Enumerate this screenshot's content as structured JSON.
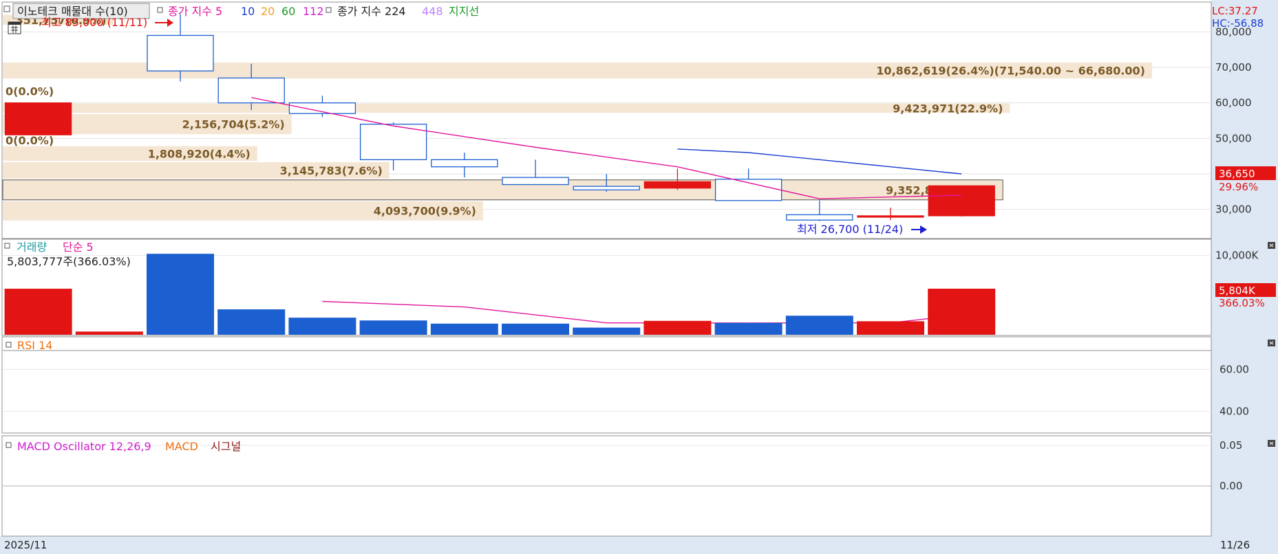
{
  "price_panel": {
    "title": "이노테크 매물대 수(10)",
    "legend": [
      {
        "label": "종가 지수 5",
        "color": "#e0149b"
      },
      {
        "label": "10",
        "color": "#1b3ccf"
      },
      {
        "label": "20",
        "color": "#f0a020"
      },
      {
        "label": "60",
        "color": "#1e9a28"
      },
      {
        "label": "112",
        "color": "#d020d0"
      },
      {
        "label": "종가 지수 224",
        "color": "#222222"
      },
      {
        "label": "448",
        "color": "#c080ff"
      },
      {
        "label": "지지선",
        "color": "#1e9a28"
      }
    ],
    "lc_text": "LC:37.27",
    "hc_text": "HC:-56.88",
    "current_price": "36,650",
    "current_change": "29.96%",
    "high_note": "최고 85,000 (11/11)",
    "low_note": "최저 26,700 (11/24)",
    "volume_profile_labels": [
      "351,757(0.9%)",
      "10,862,619(26.4%)(71,540.00 ~ 66,680.00)",
      "0(0.0%)",
      "9,423,971(22.9%)",
      "2,156,704(5.2%)",
      "0(0.0%)",
      "1,808,920(4.4%)",
      "3,145,783(7.6%)",
      "9,352,887(22.7%)",
      "4,093,700(9.9%)"
    ]
  },
  "volume_panel": {
    "title": "거래량",
    "ma_label": "단순 5",
    "info": "5,803,777주(366.03%)",
    "current_value": "5,804K",
    "current_pct": "366.03%"
  },
  "rsi_panel": {
    "title": "RSI 14"
  },
  "macd_panel": {
    "title": "MACD Oscillator 12,26,9",
    "macd_label": "MACD",
    "signal_label": "시그널"
  },
  "x_axis": {
    "start_label": "2025/11",
    "end_label": "11/26"
  },
  "chart_data": [
    {
      "type": "candlestick",
      "title": "이노테크 매물대 수(10)",
      "categories": [
        "1",
        "2",
        "3",
        "4",
        "5",
        "6",
        "7",
        "8",
        "9",
        "10",
        "11",
        "12",
        "13",
        "14"
      ],
      "open": [
        51000,
        null,
        69000,
        67000,
        60000,
        54000,
        42000,
        39000,
        36500,
        36000,
        38500,
        28500,
        28200,
        28200
      ],
      "close": [
        60000,
        null,
        79000,
        60000,
        57000,
        44000,
        44000,
        37000,
        35500,
        37800,
        32500,
        27000,
        28000,
        36650
      ],
      "high": [
        60000,
        null,
        85000,
        71000,
        62000,
        54500,
        46000,
        44000,
        40000,
        41500,
        41500,
        32500,
        30500,
        36650
      ],
      "low": [
        51000,
        null,
        66000,
        58000,
        56000,
        41000,
        39000,
        37000,
        35000,
        35500,
        32500,
        26700,
        27000,
        28000
      ],
      "up": [
        true,
        false,
        false,
        false,
        false,
        false,
        false,
        false,
        false,
        true,
        false,
        false,
        true,
        true
      ],
      "ma5": [
        null,
        null,
        null,
        61500,
        null,
        53500,
        null,
        47500,
        null,
        42000,
        null,
        33000,
        null,
        34000
      ],
      "ma10": [
        null,
        null,
        null,
        null,
        null,
        null,
        null,
        null,
        null,
        47000,
        46000,
        44000,
        42000,
        40000
      ],
      "high_note_value": 85000,
      "low_note_value": 26700,
      "ylim": [
        22000,
        88000
      ],
      "y_ticks": [
        30000,
        40000,
        50000,
        60000,
        70000,
        80000
      ],
      "y_tick_labels": [
        "30,000",
        "40,000",
        "50,000",
        "60,000",
        "70,000",
        "80,000"
      ],
      "volume_profile": [
        {
          "low": 81800,
          "high": 85000,
          "label_index": 0
        },
        {
          "low": 66680,
          "high": 71540,
          "label_index": 1
        },
        {
          "low": 60000,
          "high": 66680,
          "label_index": 2
        },
        {
          "low": 57000,
          "high": 60000,
          "label_index": 3
        },
        {
          "low": 51000,
          "high": 57000,
          "label_index": 4
        },
        {
          "low": 48000,
          "high": 51000,
          "label_index": 5
        },
        {
          "low": 43500,
          "high": 48000,
          "label_index": 6
        },
        {
          "low": 38500,
          "high": 43500,
          "label_index": 7
        },
        {
          "low": 32500,
          "high": 38500,
          "label_index": 8
        },
        {
          "low": 26700,
          "high": 32500,
          "label_index": 9
        }
      ],
      "volume_profile_values": [
        351757,
        10862619,
        0,
        9423971,
        2156704,
        0,
        1808920,
        3145783,
        9352887,
        4093700
      ],
      "highlight_band_index": 8
    },
    {
      "type": "bar",
      "title": "거래량",
      "categories": [
        "1",
        "2",
        "3",
        "4",
        "5",
        "6",
        "7",
        "8",
        "9",
        "10",
        "11",
        "12",
        "13",
        "14"
      ],
      "values": [
        5800,
        400,
        10200,
        3200,
        2150,
        1800,
        1400,
        1400,
        900,
        1750,
        1500,
        2400,
        1700,
        5804
      ],
      "up": [
        true,
        true,
        false,
        false,
        false,
        false,
        false,
        false,
        false,
        true,
        false,
        false,
        true,
        true
      ],
      "ma5": [
        null,
        null,
        null,
        null,
        4200,
        null,
        3500,
        null,
        1500,
        null,
        1480,
        null,
        1500,
        2500
      ],
      "ylim": [
        0,
        11000
      ],
      "y_ticks": [
        10000
      ],
      "y_tick_labels": [
        "10,000K"
      ]
    },
    {
      "type": "line",
      "title": "RSI 14",
      "series": [],
      "ylim": [
        30,
        75
      ],
      "y_ticks": [
        40,
        60
      ],
      "y_tick_labels": [
        "40.00",
        "60.00"
      ]
    },
    {
      "type": "line",
      "title": "MACD Oscillator 12,26,9",
      "series": [],
      "ylim": [
        -0.06,
        0.06
      ],
      "y_ticks": [
        0,
        0.05
      ],
      "y_tick_labels": [
        "0.00",
        "0.05"
      ]
    }
  ]
}
